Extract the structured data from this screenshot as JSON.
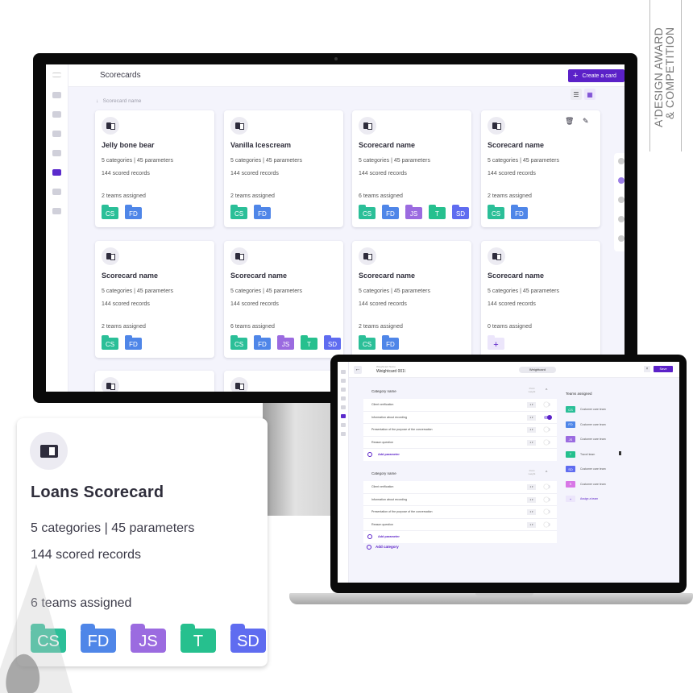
{
  "award": {
    "line1": "A'DESIGN AWARD",
    "line2": "& COMPETITION"
  },
  "desktop": {
    "page_title": "Scorecards",
    "create_button": "Create a card",
    "sort_label": "Scorecard name",
    "view_list_icon": "☰",
    "view_grid_icon": "▦",
    "nav_items": [
      "menu",
      "dashboard",
      "media",
      "training",
      "teams",
      "scorecards",
      "reports",
      "profile"
    ],
    "active_nav": "scorecards",
    "cards": [
      {
        "name": "Jelly bone bear",
        "meta": "5 categories | 45 parameters",
        "records": "144 scored records",
        "teams": "2 teams assigned",
        "tags": [
          "CS",
          "FD"
        ]
      },
      {
        "name": "Vanilla Icescream",
        "meta": "5 categories | 45 parameters",
        "records": "144 scored records",
        "teams": "2 teams assigned",
        "tags": [
          "CS",
          "FD"
        ]
      },
      {
        "name": "Scorecard name",
        "meta": "5 categories | 45 parameters",
        "records": "144 scored records",
        "teams": "6 teams assigned",
        "tags": [
          "CS",
          "FD",
          "JS",
          "T",
          "SD"
        ]
      },
      {
        "name": "Scorecard name",
        "meta": "5 categories | 45 parameters",
        "records": "144 scored records",
        "teams": "2 teams assigned",
        "tags": [
          "CS",
          "FD"
        ],
        "actions": [
          "delete",
          "edit"
        ]
      },
      {
        "name": "Scorecard name",
        "meta": "5 categories | 45 parameters",
        "records": "144 scored records",
        "teams": "2 teams assigned",
        "tags": [
          "CS",
          "FD"
        ]
      },
      {
        "name": "Scorecard name",
        "meta": "5 categories | 45 parameters",
        "records": "144 scored records",
        "teams": "6 teams assigned",
        "tags": [
          "CS",
          "FD",
          "JS",
          "T",
          "SD"
        ]
      },
      {
        "name": "Scorecard name",
        "meta": "5 categories | 45 parameters",
        "records": "144 scored records",
        "teams": "2 teams assigned",
        "tags": [
          "CS",
          "FD"
        ]
      },
      {
        "name": "Scorecard name",
        "meta": "5 categories | 45 parameters",
        "records": "144 scored records",
        "teams": "0 teams assigned",
        "tags": [
          "+"
        ]
      }
    ]
  },
  "tag_colors": {
    "CS": "#2bbf98",
    "FD": "#4f86e8",
    "JS": "#9b6be0",
    "T": "#26c08e",
    "SD": "#5f6cf0",
    "S": "#d877e6",
    "+": "#ece6fb"
  },
  "laptop": {
    "weightcard_label": "Weightcard Name",
    "weightcard_value": "Weightcard 001\\",
    "pill": "Weightcard",
    "close": "×",
    "save": "Save",
    "categories": [
      {
        "name": "Category name",
        "weight_label": "Point weight",
        "params": [
          {
            "name": "Client verification",
            "weight": "1 ▾",
            "on": false
          },
          {
            "name": "Information about recording",
            "weight": "1 ▾",
            "on": true
          },
          {
            "name": "Presentation of the purpose of the conversation",
            "weight": "1 ▾",
            "on": false
          },
          {
            "name": "Reason question",
            "weight": "1 ▾",
            "on": false
          }
        ],
        "add_param": "Add parameter"
      },
      {
        "name": "Category name",
        "weight_label": "Point weight",
        "params": [
          {
            "name": "Client verification",
            "weight": "1 ▾",
            "on": false
          },
          {
            "name": "Information about recording",
            "weight": "1 ▾",
            "on": false
          },
          {
            "name": "Presentation of the purpose of the conversation",
            "weight": "1 ▾",
            "on": false
          },
          {
            "name": "Reason question",
            "weight": "1 ▾",
            "on": false
          }
        ],
        "add_param": "Add parameter"
      }
    ],
    "add_category": "Add category",
    "teams_header": "Teams assigned",
    "teams": [
      {
        "tag": "CS",
        "name": "Customer care team"
      },
      {
        "tag": "FD",
        "name": "Customer care team"
      },
      {
        "tag": "JS",
        "name": "Customer care team"
      },
      {
        "tag": "T",
        "name": "Travel team"
      },
      {
        "tag": "SD",
        "name": "Customer care team"
      },
      {
        "tag": "S",
        "name": "Customer care team"
      },
      {
        "tag": "+",
        "name": "Assign a team"
      }
    ]
  },
  "featured_card": {
    "name": "Loans  Scorecard",
    "meta": "5 categories | 45 parameters",
    "records": "144 scored records",
    "teams": "6 teams assigned",
    "tags": [
      "CS",
      "FD",
      "JS",
      "T",
      "SD"
    ]
  }
}
